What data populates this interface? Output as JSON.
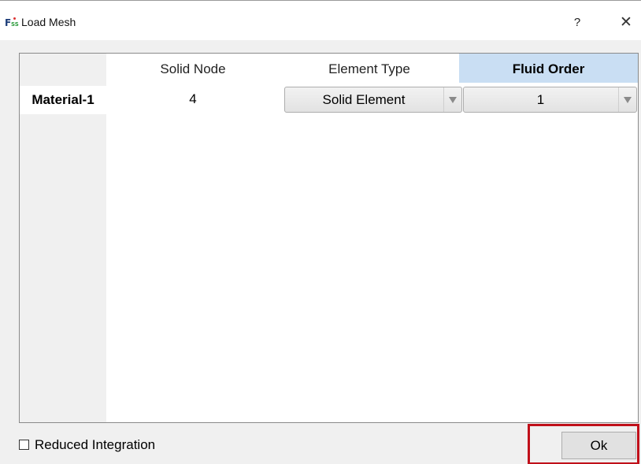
{
  "window": {
    "title": "Load Mesh",
    "icon_text": "F",
    "icon_sub": "SS",
    "help_label": "?",
    "close_label": "✕"
  },
  "table": {
    "columns": [
      {
        "label": "Solid Node",
        "selected": false
      },
      {
        "label": "Element Type",
        "selected": false
      },
      {
        "label": "Fluid Order",
        "selected": true
      }
    ],
    "rows": [
      {
        "label": "Material-1",
        "solid_node": "4",
        "element_type": "Solid Element",
        "fluid_order": "1"
      }
    ]
  },
  "options": {
    "reduced_integration_label": "Reduced Integration",
    "reduced_integration_checked": false
  },
  "buttons": {
    "ok_label": "Ok"
  },
  "colors": {
    "selected_header": "#c9def3",
    "highlight_border": "#c0101a",
    "window_bg": "#f0f0f0"
  }
}
